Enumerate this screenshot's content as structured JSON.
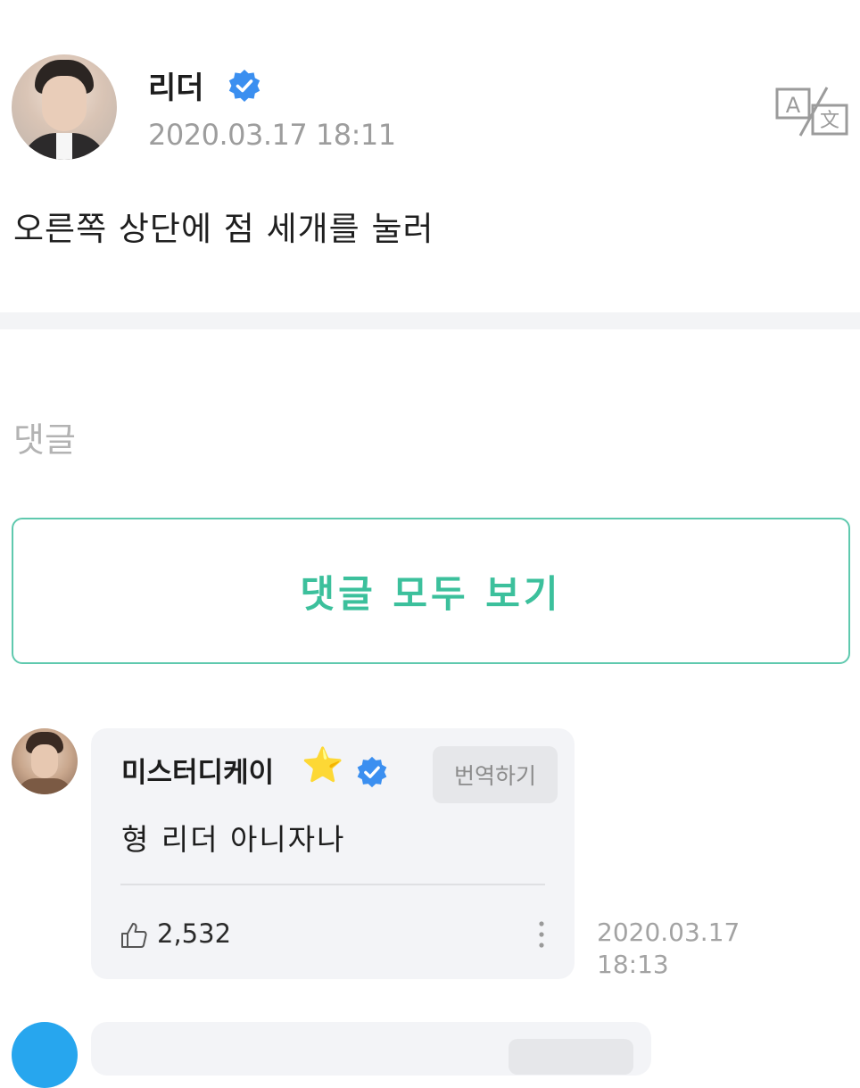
{
  "post": {
    "author_name": "리더",
    "date": "2020.03.17 18:11",
    "body": "오른쪽 상단에 점 세개를 눌러"
  },
  "comments_section": {
    "heading": "댓글",
    "view_all_label": "댓글 모두 보기"
  },
  "comments": [
    {
      "author_name": "미스터디케이",
      "star": "⭐",
      "text": "형 리더 아니자나",
      "translate_label": "번역하기",
      "likes": "2,532",
      "date_line1": "2020.03.17",
      "date_line2": "18:13"
    }
  ],
  "colors": {
    "accent": "#3cc09c",
    "verified": "#3b8ff0",
    "card": "#f3f4f7"
  },
  "icons": {
    "verified": "verified-badge-icon",
    "translate": "translate-icon",
    "like": "thumbs-up-icon",
    "more": "more-vertical-icon"
  }
}
